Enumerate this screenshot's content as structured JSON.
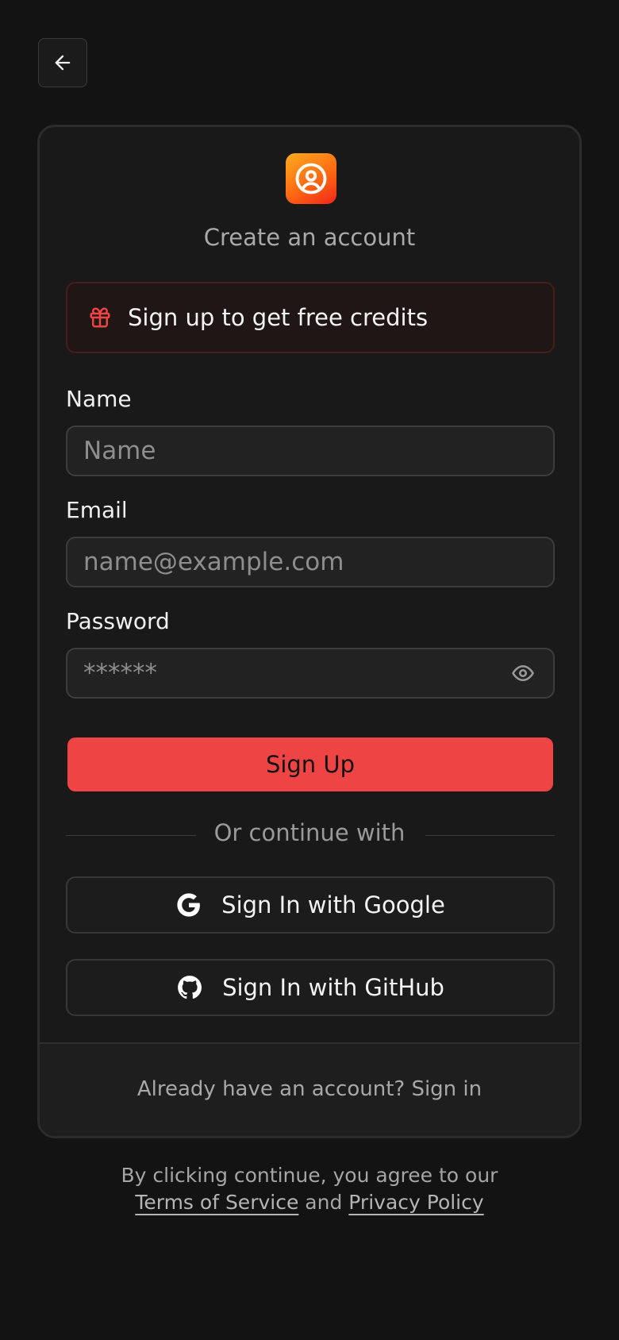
{
  "header": {
    "back_icon": "arrow-left-icon"
  },
  "card": {
    "logo_icon": "user-circle-icon",
    "logo_gradient": [
      "#ffab1f",
      "#f0251a"
    ],
    "title": "Create an account",
    "promo": {
      "icon": "gift-icon",
      "text": "Sign up to get free credits"
    },
    "form": {
      "name_label": "Name",
      "name_placeholder": "Name",
      "email_label": "Email",
      "email_placeholder": "name@example.com",
      "password_label": "Password",
      "password_placeholder": "******",
      "password_toggle_icon": "eye-icon"
    },
    "submit_label": "Sign Up",
    "divider_text": "Or continue with",
    "google_label": "Sign In with Google",
    "github_label": "Sign In with GitHub",
    "footer": {
      "prompt": "Already have an account?",
      "link": "Sign in"
    }
  },
  "legal": {
    "prefix": "By clicking continue, you agree to our",
    "terms": "Terms of Service",
    "and": "and",
    "privacy": "Privacy Policy"
  },
  "colors": {
    "background": "#131313",
    "card": "#191919",
    "accent": "#ef4444",
    "promo_border": "#4a1c1c"
  }
}
